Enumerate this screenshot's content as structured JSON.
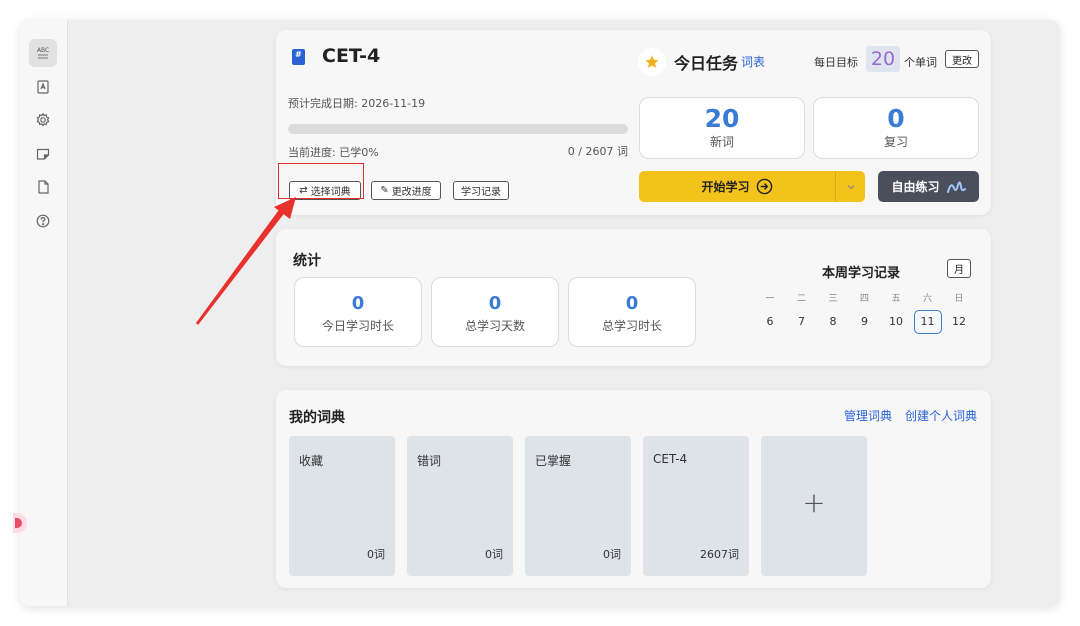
{
  "dictionary": {
    "title": "CET-4",
    "due_label": "预计完成日期: 2026-11-19",
    "progress_label": "当前进度: 已学0%",
    "progress_fraction": 0,
    "progress_count": "0 / 2607 词",
    "buttons": {
      "select": "选择词典",
      "change_progress": "更改进度",
      "history": "学习记录"
    }
  },
  "task": {
    "title": "今日任务",
    "wordlist_link": "词表",
    "goal_label": "每日目标",
    "goal_value": "20",
    "goal_unit": "个单词",
    "change_btn": "更改",
    "new_words": {
      "value": "20",
      "label": "新词"
    },
    "review": {
      "value": "0",
      "label": "复习"
    },
    "start_label": "开始学习",
    "free_label": "自由练习"
  },
  "stats": {
    "title": "统计",
    "items": [
      {
        "value": "0",
        "label": "今日学习时长"
      },
      {
        "value": "0",
        "label": "总学习天数"
      },
      {
        "value": "0",
        "label": "总学习时长"
      }
    ]
  },
  "week": {
    "title": "本周学习记录",
    "month_btn": "月",
    "weekdays": [
      "一",
      "二",
      "三",
      "四",
      "五",
      "六",
      "日"
    ],
    "dates": [
      "6",
      "7",
      "8",
      "9",
      "10",
      "11",
      "12"
    ],
    "today_index": 5
  },
  "my_dicts": {
    "title": "我的词典",
    "manage_link": "管理词典",
    "create_link": "创建个人词典",
    "tiles": [
      {
        "name": "收藏",
        "count": "0词"
      },
      {
        "name": "错词",
        "count": "0词"
      },
      {
        "name": "已掌握",
        "count": "0词"
      },
      {
        "name": "CET-4",
        "count": "2607词"
      }
    ],
    "add_symbol": "+"
  },
  "sidebar": {
    "icons": [
      "abc-icon",
      "dictionary-icon",
      "settings-icon",
      "notes-icon",
      "document-icon",
      "help-icon"
    ]
  },
  "colors": {
    "accent": "#3a7bd5",
    "start": "#f3c31c",
    "free": "#4a4f5b",
    "arrow": "#e8312c"
  }
}
